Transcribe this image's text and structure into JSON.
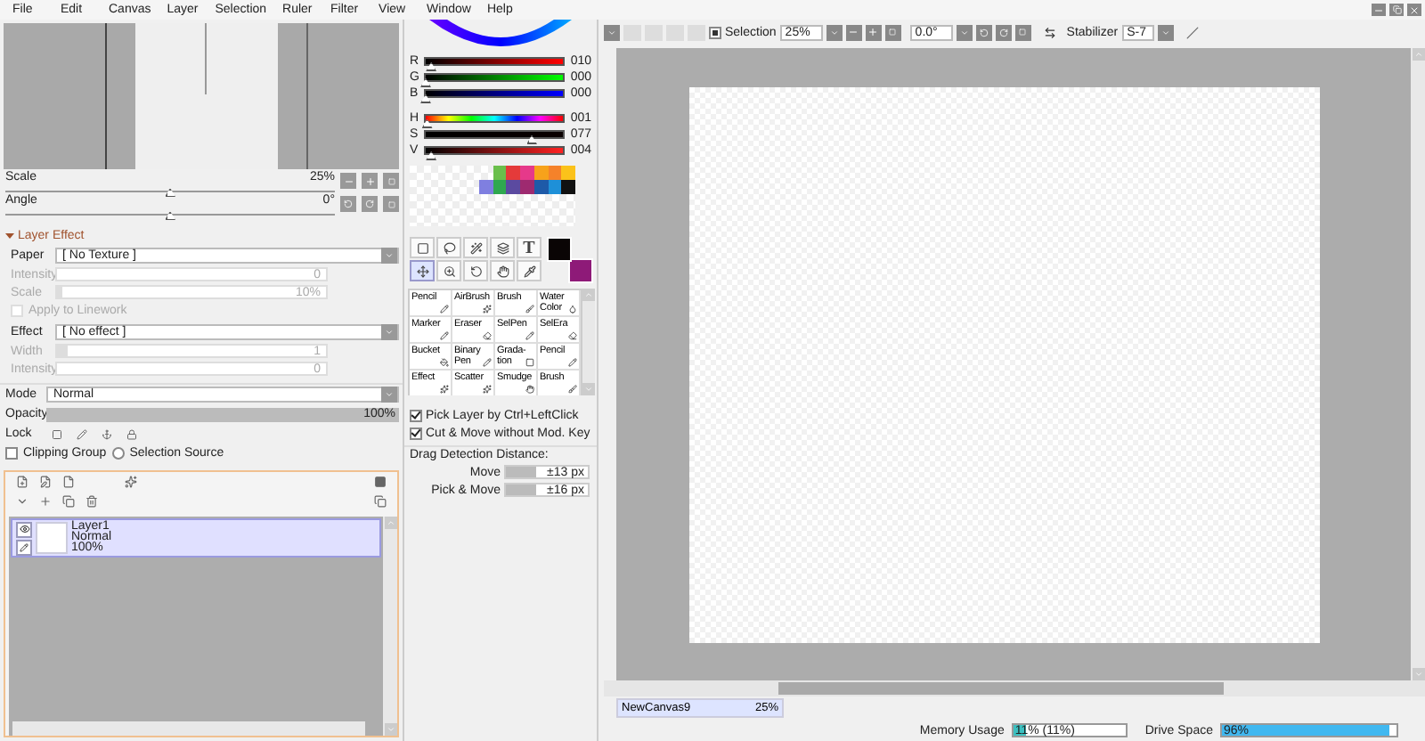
{
  "menu": [
    {
      "label": "File"
    },
    {
      "label": "Edit"
    },
    {
      "label": "Canvas"
    },
    {
      "label": "Layer"
    },
    {
      "label": "Selection"
    },
    {
      "label": "Ruler"
    },
    {
      "label": "Filter"
    },
    {
      "label": "View"
    },
    {
      "label": "Window"
    },
    {
      "label": "Help"
    }
  ],
  "navigator": {
    "scale": {
      "label": "Scale",
      "value": "25%",
      "level": 0.5
    },
    "angle": {
      "label": "Angle",
      "value": "0°",
      "level": 0.5
    }
  },
  "layer_effect": {
    "title": "Layer Effect",
    "expanded": true,
    "paper": {
      "label": "Paper",
      "value": "[ No Texture ]"
    },
    "paper_intensity": {
      "label": "Intensity",
      "value": "0",
      "disabled": true
    },
    "paper_scale": {
      "label": "Scale",
      "value": "10%",
      "level": 0.02,
      "disabled": true
    },
    "apply_to_linework": {
      "label": "Apply to Linework",
      "checked": false,
      "disabled": true
    },
    "effect": {
      "label": "Effect",
      "value": "[ No effect ]"
    },
    "effect_width": {
      "label": "Width",
      "value": "1",
      "level": 0.04,
      "disabled": true
    },
    "effect_intensity": {
      "label": "Intensity",
      "value": "0",
      "disabled": true
    }
  },
  "layer_props": {
    "mode": {
      "label": "Mode",
      "value": "Normal"
    },
    "opacity": {
      "label": "Opacity",
      "value": "100%",
      "level": 1
    },
    "lock_label": "Lock",
    "clipping_group": {
      "label": "Clipping Group",
      "checked": false
    },
    "selection_source": {
      "label": "Selection Source",
      "selected": false
    }
  },
  "layers": [
    {
      "name": "Layer1",
      "mode": "Normal",
      "opacity": "100%",
      "visible": true,
      "selected": true
    }
  ],
  "color_sliders": [
    {
      "label": "R",
      "value": "010",
      "level": 0.04
    },
    {
      "label": "G",
      "value": "000",
      "level": 0
    },
    {
      "label": "B",
      "value": "000",
      "level": 0
    },
    {
      "label": "H",
      "value": "001",
      "level": 0.01
    },
    {
      "label": "S",
      "value": "077",
      "level": 0.77
    },
    {
      "label": "V",
      "value": "004",
      "level": 0.04
    }
  ],
  "swatch_rows": [
    {
      "swatches": [
        {
          "kind": "empty"
        },
        {
          "kind": "empty"
        },
        {
          "kind": "empty"
        },
        {
          "kind": "empty"
        },
        {
          "kind": "empty"
        },
        {
          "kind": "empty"
        },
        {
          "kind": "color",
          "color": "#6abf4b"
        },
        {
          "kind": "color",
          "color": "#e53a3a"
        },
        {
          "kind": "color",
          "color": "#e6398a"
        },
        {
          "kind": "color",
          "color": "#f7a21b"
        },
        {
          "kind": "color",
          "color": "#f5822a"
        },
        {
          "kind": "color",
          "color": "#fbc21a"
        }
      ]
    },
    {
      "swatches": [
        {
          "kind": "empty"
        },
        {
          "kind": "empty"
        },
        {
          "kind": "empty"
        },
        {
          "kind": "empty"
        },
        {
          "kind": "empty"
        },
        {
          "kind": "color",
          "color": "#7f7fe0"
        },
        {
          "kind": "color",
          "color": "#2fa84f"
        },
        {
          "kind": "color",
          "color": "#5b4aa0"
        },
        {
          "kind": "color",
          "color": "#9e2a70"
        },
        {
          "kind": "color",
          "color": "#1e5aa8"
        },
        {
          "kind": "color",
          "color": "#1e90d8"
        },
        {
          "kind": "color",
          "color": "#111111"
        }
      ]
    }
  ],
  "tools": [
    {
      "kind": "icon",
      "selected": false
    },
    {
      "kind": "icon",
      "selected": false
    },
    {
      "kind": "icon",
      "selected": false
    },
    {
      "kind": "icon",
      "selected": false
    },
    {
      "kind": "text",
      "label": "T",
      "selected": false
    },
    {
      "kind": "icon",
      "selected": true
    },
    {
      "kind": "icon",
      "selected": false
    },
    {
      "kind": "icon",
      "selected": false
    },
    {
      "kind": "icon",
      "selected": false
    },
    {
      "kind": "icon",
      "selected": false
    }
  ],
  "primary_color": {
    "color": "#0a0505"
  },
  "secondary_color": {
    "color": "#8e1a78"
  },
  "brushes": [
    {
      "name": "Pencil"
    },
    {
      "name": "AirBrush"
    },
    {
      "name": "Brush"
    },
    {
      "name": "Water Color"
    },
    {
      "name": "Marker"
    },
    {
      "name": "Eraser"
    },
    {
      "name": "SelPen"
    },
    {
      "name": "SelEra"
    },
    {
      "name": "Bucket"
    },
    {
      "name": "Binary Pen"
    },
    {
      "name": "Grada- tion"
    },
    {
      "name": "Pencil"
    },
    {
      "name": "Effect"
    },
    {
      "name": "Scatter"
    },
    {
      "name": "Smudge"
    },
    {
      "name": "Brush"
    }
  ],
  "options": [
    {
      "label": "Pick Layer by Ctrl+LeftClick",
      "checked": true
    },
    {
      "label": "Cut & Move without Mod. Key",
      "checked": true
    }
  ],
  "drag_detection": {
    "title": "Drag Detection Distance:",
    "rows": [
      {
        "label": "Move",
        "value": "±13 px",
        "level": 0.36
      },
      {
        "label": "Pick & Move",
        "value": "±16 px",
        "level": 0.38
      }
    ]
  },
  "toolbar": {
    "selection": {
      "label": "Selection",
      "checked": true
    },
    "zoom": "25%",
    "angle": "0.0°",
    "stabilizer": {
      "label": "Stabilizer",
      "value": "S-7"
    }
  },
  "canvas_tabs": [
    {
      "name": "NewCanvas9",
      "zoom": "25%",
      "selected": true
    }
  ],
  "status_bar": {
    "memory": {
      "label": "Memory Usage",
      "value": "11% (11%)",
      "level": 0.11
    },
    "drive": {
      "label": "Drive Space",
      "value": "96%",
      "level": 0.96
    }
  }
}
